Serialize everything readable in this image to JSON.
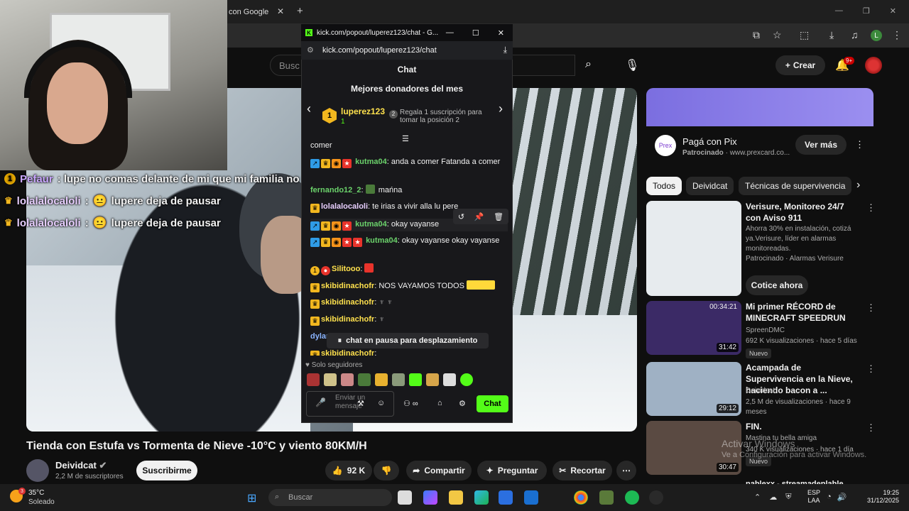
{
  "browser": {
    "tab_title": "con Google",
    "tab_close": "✕",
    "new_tab": "+",
    "profile_initial": "L"
  },
  "youtube": {
    "search_placeholder": "Busc",
    "create_label": "Crear",
    "notif_badge": "9+",
    "video_title": "Tienda con Estufa vs Tormenta de Nieve -10°C y viento 80KM/H",
    "channel_name": "Deividcat",
    "channel_subs": "2,2 M de suscriptores",
    "subscribe_label": "Suscribirme",
    "likes": "92 K",
    "share_label": "Compartir",
    "ask_label": "Preguntar",
    "clip_label": "Recortar"
  },
  "overlay_chat": [
    {
      "user": "Pefaur",
      "text": ": lupe no comas delante de mi que mi familia no tiene para comer",
      "badge": "1",
      "user_color": "#c9a6ff"
    },
    {
      "user": "lolalalocaloli",
      "text": "lupere deja de pausar",
      "badge": "crown",
      "user_color": "#e8cfff"
    },
    {
      "user": "lolalalocaloli",
      "text": "lupere deja de pausar",
      "badge": "crown",
      "user_color": "#e8cfff"
    }
  ],
  "sidebar": {
    "ad_title": "Pagá con Pix",
    "ad_sponsor": "Patrocinado",
    "ad_url": "www.prexcard.co...",
    "ad_logo": "Prex",
    "ad_button": "Ver más",
    "chips": [
      "Todos",
      "Deividcat",
      "Técnicas de supervivencia"
    ],
    "recs": [
      {
        "title": "Verisure, Monitoreo 24/7 con Aviso 911",
        "meta": "Ahorra 30% en instalación, cotizá ya.Verisure, líder en alarmas monitoreadas.",
        "channel": "Patrocinado · Alarmas Verisure",
        "duration": "",
        "cta": "Cotice ahora",
        "thumb": "#e7ebee"
      },
      {
        "title": "Mi primer RÉCORD de MINECRAFT SPEEDRUN",
        "meta": "SpreenDMC",
        "channel": "692 K visualizaciones · hace 5 días",
        "duration": "31:42",
        "overlay_time": "00:34:21",
        "tag": "Nuevo",
        "thumb": "#3b2a66"
      },
      {
        "title": "Acampada de Supervivencia en la Nieve, haciendo bacon a ...",
        "meta": "Deividcat",
        "channel": "2,5 M de visualizaciones · hace 9 meses",
        "duration": "29:12",
        "thumb": "#9fb1c4"
      },
      {
        "title": "FIN.",
        "meta": "Mastina tu bella amiga",
        "channel": "340 K visualizaciones · hace 1 día",
        "duration": "30:47",
        "tag": "Nuevo",
        "thumb": "#5a4a42"
      }
    ],
    "last_rec": "nablexx - streamadeplable (Full"
  },
  "kick": {
    "window_title": "kick.com/popout/luperez123/chat - G...",
    "url": "kick.com/popout/luperez123/chat",
    "header": "Chat",
    "donors_title": "Mejores donadores del mes",
    "top_donor": "luperez123",
    "top_donor_count": "1",
    "gift_text": "Regala 1 suscripción para tomar la posición 2",
    "messages": [
      {
        "user": "",
        "text": "comer",
        "color": "#fff"
      },
      {
        "user": "kutma04",
        "text": "anda a comer Fatanda a comer",
        "color": "#6bd26b"
      },
      {
        "user": "fernando12_2",
        "text": "mańna",
        "color": "#6bd26b"
      },
      {
        "user": "lolalalocaloli",
        "text": "te irias a vivir alla lu pere",
        "color": "#e8cfff"
      },
      {
        "user": "kutma04",
        "text": "okay vayanse",
        "color": "#6bd26b"
      },
      {
        "user": "kutma04",
        "text": "okay vayanse okay vayanse",
        "color": "#6bd26b"
      },
      {
        "user": "Silitooo",
        "text": "",
        "color": "#ffe14d"
      },
      {
        "user": "skibidinachofr",
        "text": "NOS VAYAMOS TODOS",
        "color": "#ffe14d"
      },
      {
        "user": "skibidinachofr",
        "text": "",
        "color": "#ffe14d"
      },
      {
        "user": "skibidinachofr",
        "text": "",
        "color": "#ffe14d"
      },
      {
        "user": "dylan",
        "text": "",
        "color": "#8ab4ff"
      },
      {
        "user": "skibidinachofr",
        "text": "",
        "color": "#ffe14d"
      }
    ],
    "paused_text": "chat en pausa para desplazamiento",
    "followers_only": "Solo seguidores",
    "input_placeholder": "Enviar un mensaje",
    "send_label": "Chat"
  },
  "taskbar": {
    "temp": "35°C",
    "weather": "Soleado",
    "weather_badge": "3",
    "search": "Buscar",
    "lang_top": "ESP",
    "lang_bottom": "LAA",
    "time": "19:25",
    "date": "31/12/2025"
  },
  "watermark": {
    "title": "Activar Windows",
    "sub": "Ve a Configuración para activar Windows."
  }
}
